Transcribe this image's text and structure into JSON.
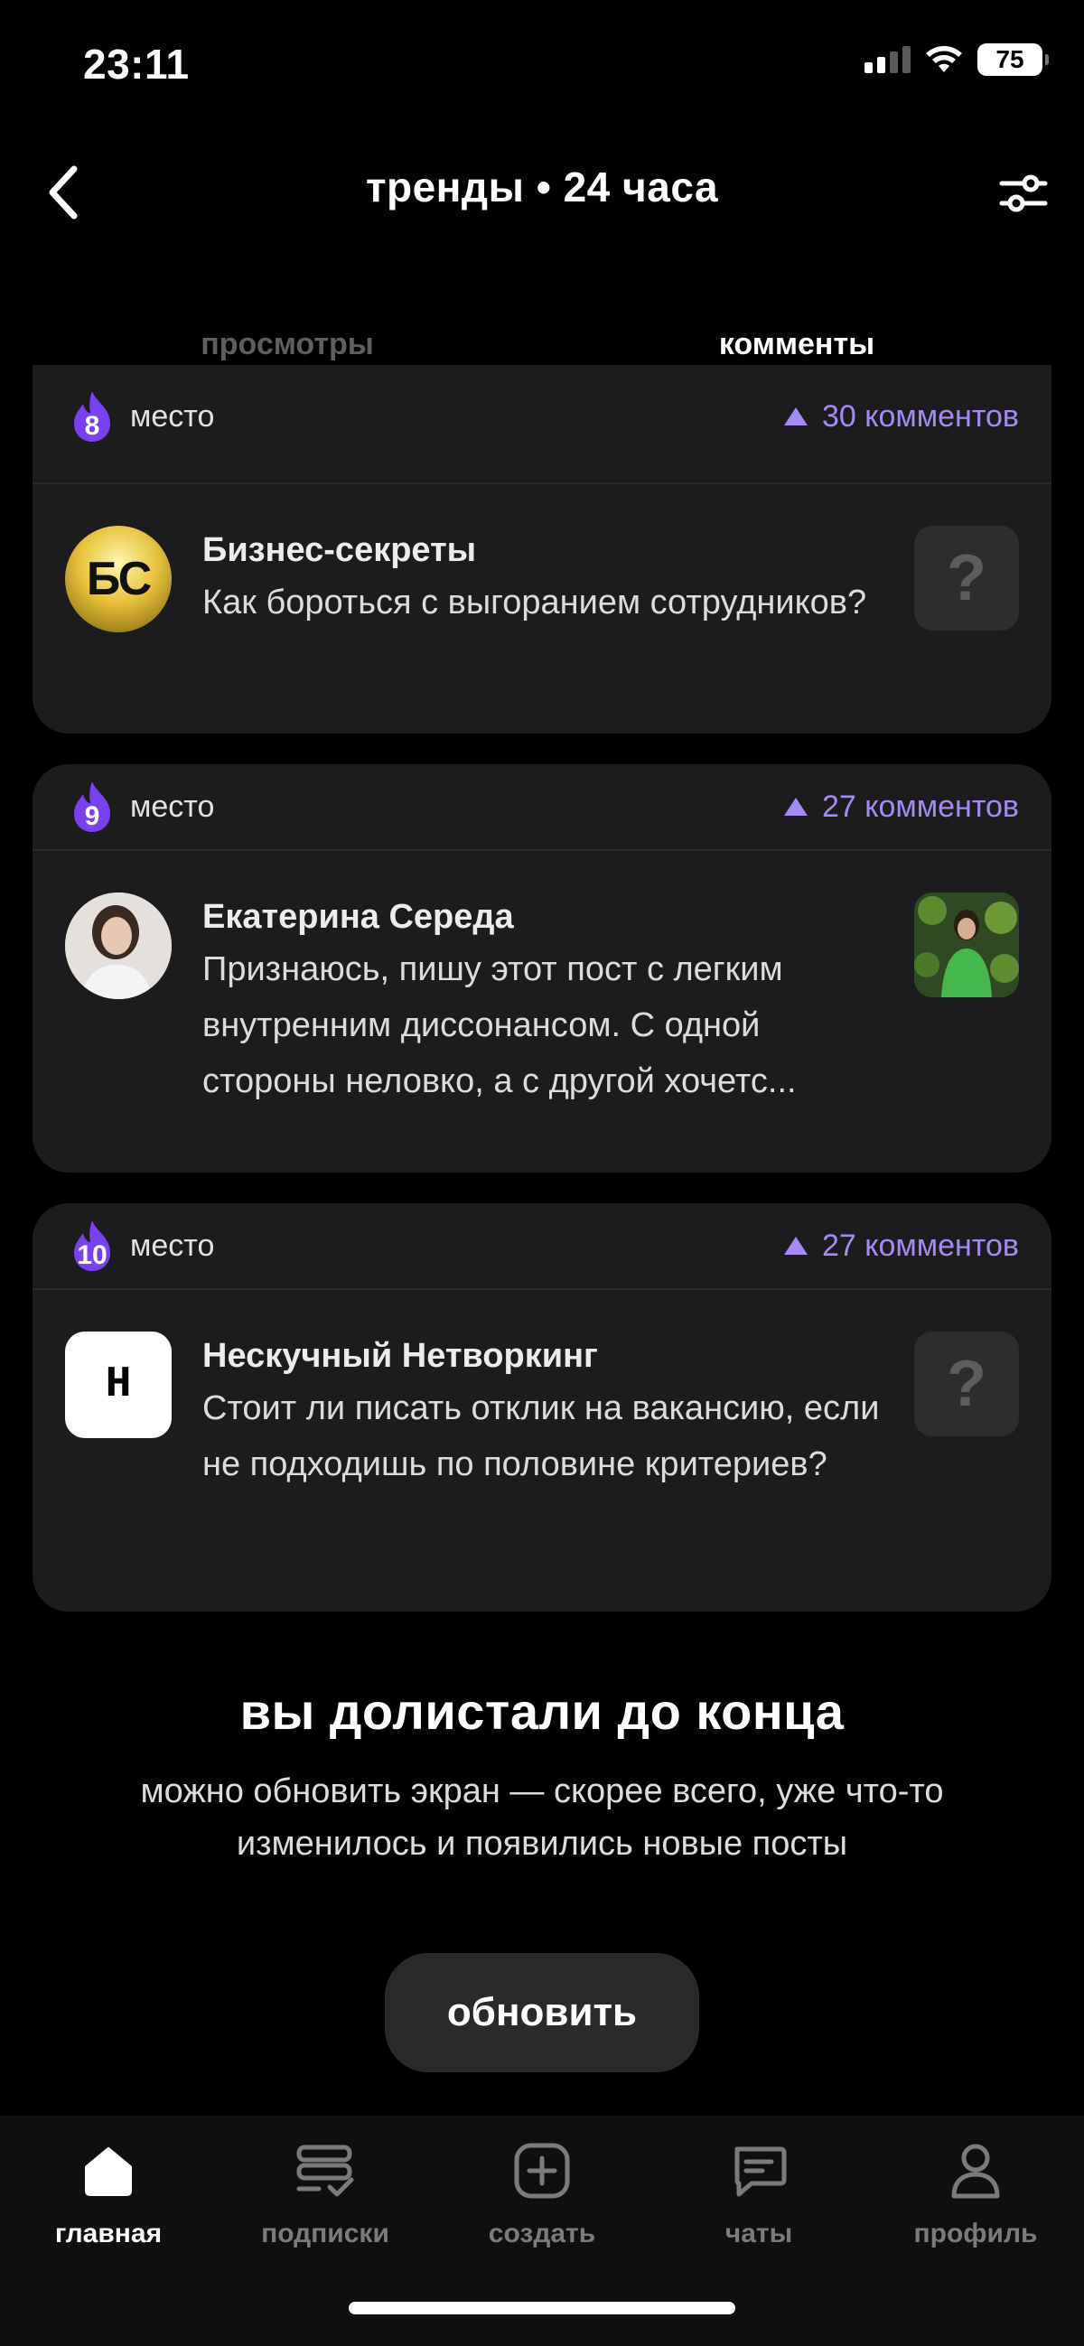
{
  "status_bar": {
    "time": "23:11",
    "battery": "75"
  },
  "header": {
    "title": "тренды • 24 часа"
  },
  "tabs": [
    {
      "label": "просмотры",
      "active": false
    },
    {
      "label": "комменты",
      "active": true
    }
  ],
  "posts": [
    {
      "rank": "8",
      "rank_label": "место",
      "comments": "30 комментов",
      "author": "Бизнес-секреты",
      "avatar_text": "БС",
      "text": "Как бороться с выгоранием сотрудников?"
    },
    {
      "rank": "9",
      "rank_label": "место",
      "comments": "27 комментов",
      "author": "Екатерина Середа",
      "text": "Признаюсь, пишу этот пост с легким внутренним диссонансом. С одной стороны неловко, а с другой хочетс..."
    },
    {
      "rank": "10",
      "rank_label": "место",
      "comments": "27 комментов",
      "author": "Нескучный Нетворкинг",
      "avatar_text": "Н",
      "text": "Стоит ли писать отклик на вакансию, если не подходишь по половине критериев?"
    }
  ],
  "end": {
    "title": "вы долистали до конца",
    "text": "можно обновить экран — скорее всего, уже что-то изменилось и появились новые посты",
    "button": "обновить"
  },
  "nav": [
    {
      "label": "главная",
      "icon": "home-icon",
      "active": true
    },
    {
      "label": "подписки",
      "icon": "subscriptions-icon",
      "active": false
    },
    {
      "label": "создать",
      "icon": "create-icon",
      "active": false
    },
    {
      "label": "чаты",
      "icon": "chat-icon",
      "active": false
    },
    {
      "label": "профиль",
      "icon": "profile-icon",
      "active": false
    }
  ],
  "colors": {
    "accent": "#a58af5",
    "flame": "#7b3ff2",
    "card": "#1c1c1e"
  }
}
